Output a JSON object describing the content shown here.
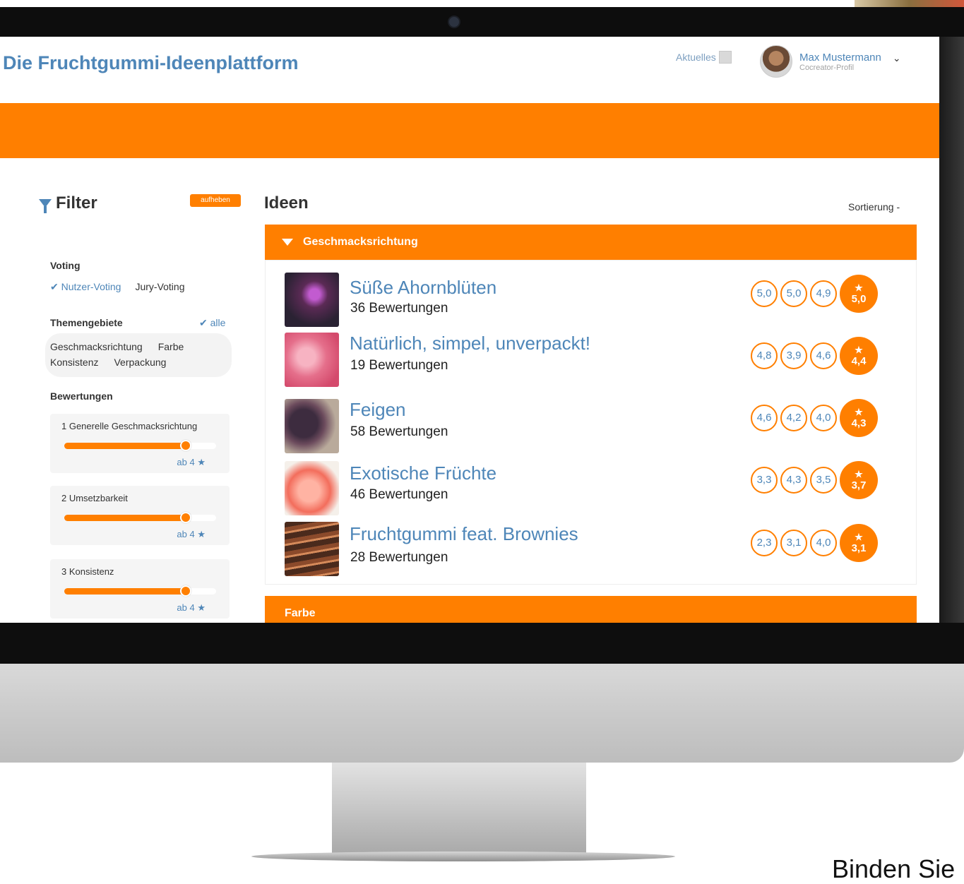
{
  "header": {
    "site_title": "Die Fruchtgummi-Ideenplattform",
    "news_label": "Aktuelles",
    "user_name": "Max Mustermann",
    "user_role": "Cocreator-Profil",
    "user_menu_icon": "chevron-down-icon"
  },
  "sidebar": {
    "title": "Filter",
    "reset_label": "aufheben",
    "voting": {
      "heading": "Voting",
      "options": [
        "Nutzer-Voting",
        "Jury-Voting"
      ],
      "selected": "Nutzer-Voting"
    },
    "topics": {
      "heading": "Themengebiete",
      "all_label": "alle",
      "items": [
        "Geschmacksrichtung",
        "Farbe",
        "Konsistenz",
        "Verpackung"
      ]
    },
    "ratings": {
      "heading": "Bewertungen",
      "items": [
        {
          "label": "1 Generelle Geschmacksrichtung",
          "min": "ab 4 ★",
          "level": 0.8
        },
        {
          "label": "2 Umsetzbarkeit",
          "min": "ab 4 ★",
          "level": 0.8
        },
        {
          "label": "3 Konsistenz",
          "min": "ab 4 ★",
          "level": 0.8
        }
      ]
    }
  },
  "main": {
    "title": "Ideen",
    "sort_label": "Sortierung -",
    "category": "Geschmacksrichtung",
    "next_category": "Farbe",
    "ideas": [
      {
        "name": "Süße Ahornblüten",
        "count": "36 Bewertungen",
        "scores": [
          "5,0",
          "5,0",
          "4,9"
        ],
        "total": "5,0"
      },
      {
        "name": "Natürlich, simpel, unverpackt!",
        "count": "19 Bewertungen",
        "scores": [
          "4,8",
          "3,9",
          "4,6"
        ],
        "total": "4,4"
      },
      {
        "name": "Feigen",
        "count": "58 Bewertungen",
        "scores": [
          "4,6",
          "4,2",
          "4,0"
        ],
        "total": "4,3"
      },
      {
        "name": "Exotische Früchte",
        "count": "46 Bewertungen",
        "scores": [
          "3,3",
          "4,3",
          "3,5"
        ],
        "total": "3,7"
      },
      {
        "name": "Fruchtgummi feat. Brownies",
        "count": "28 Bewertungen",
        "scores": [
          "2,3",
          "3,1",
          "4,0"
        ],
        "total": "3,1"
      }
    ]
  },
  "caption": "Binden Sie",
  "colors": {
    "accent": "#ff7f00",
    "link": "#4e86b8",
    "text": "#333333"
  }
}
